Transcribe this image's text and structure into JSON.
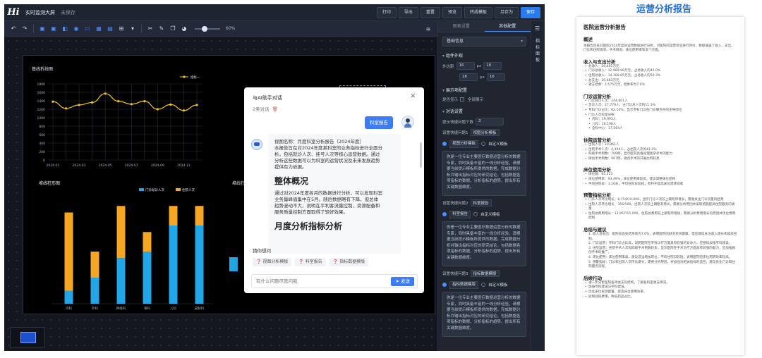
{
  "app": {
    "logo": "Hi",
    "title": "实时监测大屏",
    "save_state": "未保存",
    "actions": [
      "打印",
      "导出",
      "重置",
      "预览",
      "转成模板",
      "另存为",
      "保存"
    ]
  },
  "toolbar": {
    "zoom": "60%"
  },
  "line_chart_title": "基线折线图",
  "bar_chart_title": "堆线柱形图",
  "bar_chart_title_2": "堆线柱形图",
  "chart_data": [
    {
      "type": "line",
      "title": "基线折线图",
      "x": [
        "2024-01",
        "2024-02",
        "2024-03",
        "2024-04",
        "2024-05",
        "2024-06",
        "2024-07",
        "2024-08",
        "2024-09",
        "2024-10",
        "2024-11",
        "2024-12"
      ],
      "x_ticks": [
        "2024-01",
        "2024-03",
        "2024-05",
        "2024-07",
        "2024-09",
        "2024-11"
      ],
      "series": [
        {
          "name": "指标一",
          "values": [
            1380,
            1220,
            1300,
            1360,
            1570,
            1390,
            1320,
            1390,
            1200,
            1310,
            1170,
            1300
          ]
        }
      ],
      "ylim": [
        0,
        1800
      ],
      "y_ticks": [
        0,
        200,
        400,
        600,
        800,
        1000,
        1200,
        1400,
        1600,
        1800
      ],
      "grid": true,
      "legend": "top-right",
      "colors": [
        "#f5c518"
      ]
    },
    {
      "type": "bar",
      "title": "堆线柱形图",
      "stacked": true,
      "categories": [
        "内科",
        "外科",
        "神经科",
        "骨科",
        "儿科",
        "皮肤科"
      ],
      "series": [
        {
          "name": "门诊就诊人次",
          "values": [
            10,
            20,
            35,
            40,
            60,
            60
          ]
        },
        {
          "name": "住院人次",
          "values": [
            60,
            20,
            40,
            15,
            15,
            15
          ]
        }
      ],
      "ylim": [
        0,
        80
      ],
      "legend": "top-right",
      "colors": [
        "#21a7e8",
        "#f5a623"
      ]
    }
  ],
  "dialog": {
    "title": "与AI助手对话",
    "subtitle": "2条对话",
    "user_message": "科室报告",
    "bot_line_1": "视图名称：月度科室分析报告（2024年度）",
    "bot_line_2": "本报告旨在对2024年度某科室的业务指标进行全面分",
    "bot_line_3": "析，包括就诊人次、挂号人次等核心运营数据。通过",
    "bot_line_4": "分析这些数据可以为科室的运营状况及未来发展趋势",
    "bot_line_5": "提供有力依据。",
    "bot_heading_1": "整体概况",
    "bot_line_6": "通过对2024年度各月的数据进行分析，可以发现科室",
    "bot_line_7": "业务量峰值集中在5月。随后数据略有下降，但总体",
    "bot_line_8": "趋势波动不大，说明在平利客流量控制、资源配备和",
    "bot_line_9": "服务质量控制方面取得了较好效果。",
    "bot_heading_2": "月度分析指标分析",
    "guess_title": "猜你想问",
    "chips": [
      "视图分析模板",
      "科室报告",
      "指标数据模版"
    ],
    "input_placeholder": "有什么问题尽管问我",
    "send_label": "发送"
  },
  "panel": {
    "tabs": [
      "图表设置",
      "其他配置"
    ],
    "top_select": "基础信息",
    "sec_layout": "组件外观",
    "row_padding": "外边距",
    "num_1": "16",
    "num_2": "16",
    "num_3": "16",
    "num_4": "16",
    "unit": "px",
    "sec_display": "展示项配置",
    "show_labels": "是否显示",
    "show_label_opt": "全部展示",
    "sec_dialog": "对话设置",
    "chat_count_label": "提示快捷问题个数",
    "chat_count": "3",
    "q1_label": "设置快捷问题1",
    "q1_tag": "视图分析模板",
    "template_select": "视图分析模板",
    "custom_label": "自定义模板",
    "tpl_text": "你是一位专业主要医疗数据运营分析的数据专家，同时具备丰富的一线分析经验，请根据当前提示模板所提供的数据，完成数据分析并输出指标对应的研究结论，包括数据各项指标的数据、分析指标的趋势、提出所有关键数据维度。",
    "q2_label": "设置快捷问题2",
    "q2_tag": "科室报告",
    "template_select_2": "科室报告",
    "q3_label": "设置快捷问题3",
    "q3_tag": "指标数据模版",
    "template_select_3": "指标数据模版",
    "rail_text": "指标面板"
  },
  "doc": {
    "heading": "运营分析报告",
    "title": "医院运营分析报告",
    "s1": "概述",
    "s1_p": "本报告旨在对医院2024年度的运营数据进行分析，对医院的运营状况进行评价，数据涵盖了收入、支出、门诊和住院情况、手术情况、床位使用率等多个方面。",
    "s2": "收入与支出分析",
    "s2_items": [
      "总收入：26,461万元",
      "门诊总收入：12,989.98万元，占总收入的42.0%",
      "住院总收入：14,168.65万元，占总收入的50.3%",
      "总支出：26,463万元",
      "收支结余：1,575万元，结余率为7.0%"
    ],
    "s3": "门诊运营分析",
    "s3_items": [
      "门诊就诊人次：244,601人",
      "急诊人次：27,779人，占门诊总人次的11.3%",
      "专科门诊占比：62.14%，显示专科门诊在门诊服务中的主导地位",
      "门诊人次科室分布："
    ],
    "s3_sub": [
      "内科：19,993人",
      "儿科：16,198人",
      "全科中心：17,564人"
    ],
    "s4": "住院运营分析",
    "s4_items": [
      "出院人次：10,861人",
      "住院手术人次：4,304人，占出院人次的41.2%",
      "四级手术例数：708例，显示医院具备处理复杂手术的能力",
      "微创手术例数：967例，微创手术的开展比例较高"
    ],
    "s5": "床位使用分析",
    "s5_items": [
      "床位数：65,323",
      "床位使用率：93.49%，床位使用率较高，建议调整床位结构",
      "平均住院日：3.16天，平均住院日较短，有利于提高床位周转效率"
    ],
    "s6": "预警指标分析",
    "s6_items": [
      "门诊人次环比增长：8,754/10,000，显示门诊人次较上期有所增长，需要关注门诊流量的趋势",
      "出院人次环比增长：356/500，出院人次较上期略有增长，需要分析原因并采取措施提高住院服务的质量",
      "住院总费用增长：12,857/15,000，住院总费用较上期有所增加，需要分析费用增长的原因并优化费用结构"
    ],
    "s7": "总结与建议",
    "s7_items": [
      "1. 收入与支出：医院总收支结余率为7.0%，表明医院的财务状况健康，但应继续关注收入增长和成本控制。",
      "2. 门诊运营：专科门诊占比高，说明医院在专科诊疗方面具有较强的竞争力，应继续加强专科建设。",
      "3. 住院运营：住院手术人次和四级手术例数较多，显示医院在手术治疗方面具有较强的能力，应加强微创手术的推广。",
      "4. 床位使用：床位使用率高，建议适当增加床位，平均住院日较短，表明医院的床位周转效率较高。",
      "5. 预警指标：门诊和出院人次环比增长，需要分析原因，并加强对相关指标的监控，建议优化门诊和住院服务流程。"
    ],
    "s8": "后续行动",
    "s8_items": [
      "进一步分析医院各项收支的结构，了解各科室收支情况。",
      "加强专科建设与学科建设。",
      "优化床位资源配置，提高床位使用效率。",
      "控制住院费用，降低药品占比。"
    ]
  }
}
